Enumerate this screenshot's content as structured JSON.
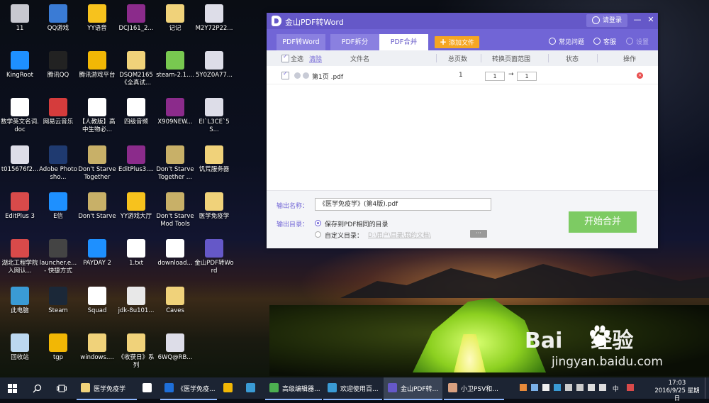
{
  "desktop": {
    "icons": [
      {
        "label": "11",
        "color": "#c8c8d0"
      },
      {
        "label": "QQ游戏",
        "color": "#3a7bd5"
      },
      {
        "label": "YY语音",
        "color": "#f7c21d"
      },
      {
        "label": "DCJ161_2...",
        "color": "#8b2b8b"
      },
      {
        "label": "记记",
        "color": "#f0d27a"
      },
      {
        "label": "M2Y72P22...",
        "color": "#dddde8"
      },
      {
        "label": "KingRoot",
        "color": "#1e90ff"
      },
      {
        "label": "腾讯QQ",
        "color": "#222222"
      },
      {
        "label": "腾讯游戏平台",
        "color": "#f2b705"
      },
      {
        "label": "DSQM2165《全真试...",
        "color": "#f0d27a"
      },
      {
        "label": "steam-2.1....",
        "color": "#78c850"
      },
      {
        "label": "5Y0Z0A77...",
        "color": "#dddde8"
      },
      {
        "label": "数学英文名词.doc",
        "color": "#ffffff"
      },
      {
        "label": "网易云音乐",
        "color": "#d53c3c"
      },
      {
        "label": "【人教版】高中生物必...",
        "color": "#ffffff"
      },
      {
        "label": "四级音频",
        "color": "#ffffff"
      },
      {
        "label": "X909NEW...",
        "color": "#8b2b8b"
      },
      {
        "label": "EI`L3CE`5S...",
        "color": "#dddde8"
      },
      {
        "label": "t015676f2...",
        "color": "#dddde8"
      },
      {
        "label": "Adobe Photosho...",
        "color": "#1f3a70"
      },
      {
        "label": "Don't Starve Together",
        "color": "#c8b068"
      },
      {
        "label": "EditPlus3....",
        "color": "#8b2b8b"
      },
      {
        "label": "Don't Starve Together ...",
        "color": "#c8b068"
      },
      {
        "label": "饥荒服务器",
        "color": "#f0d27a"
      },
      {
        "label": "EditPlus 3",
        "color": "#d84a4a"
      },
      {
        "label": "E信",
        "color": "#1e90ff"
      },
      {
        "label": "Don't Starve",
        "color": "#c8b068"
      },
      {
        "label": "YY游戏大厅",
        "color": "#f7c21d"
      },
      {
        "label": "Don't Starve Mod Tools",
        "color": "#c8b068"
      },
      {
        "label": "医学免疫学",
        "color": "#f0d27a"
      },
      {
        "label": "湖北工程学院入网认...",
        "color": "#d84a4a"
      },
      {
        "label": "launcher.e... - 快捷方式",
        "color": "#444444"
      },
      {
        "label": "PAYDAY 2",
        "color": "#1e90ff"
      },
      {
        "label": "1.txt",
        "color": "#ffffff"
      },
      {
        "label": "download...",
        "color": "#ffffff"
      },
      {
        "label": "金山PDF转Word",
        "color": "#6558c8"
      },
      {
        "label": "此电脑",
        "color": "#3a9bd5"
      },
      {
        "label": "Steam",
        "color": "#1b2838"
      },
      {
        "label": "Squad",
        "color": "#ffffff"
      },
      {
        "label": "jdk-8u101...",
        "color": "#e8e8e8"
      },
      {
        "label": "Caves",
        "color": "#f0d27a"
      },
      {
        "label": "回收站",
        "color": "#bcd8f0"
      },
      {
        "label": "tgp",
        "color": "#f2b705"
      },
      {
        "label": "windows....",
        "color": "#f0d27a"
      },
      {
        "label": "《收获日》系列",
        "color": "#f0d27a"
      },
      {
        "label": "6WQ@RB...",
        "color": "#dddde8"
      }
    ]
  },
  "window": {
    "title": "金山PDF转Word",
    "login_label": "请登录",
    "minimize_icon": "—",
    "close_icon": "✕",
    "tabs": [
      {
        "label": "PDF转Word"
      },
      {
        "label": "PDF拆分"
      },
      {
        "label": "PDF合并"
      }
    ],
    "add_file_label": "添加文件",
    "add_file_icon": "+",
    "tools": {
      "faq": "常见问题",
      "service": "客服",
      "settings": "设置"
    },
    "table": {
      "headers": {
        "select_all": "全选",
        "clear": "清除",
        "filename": "文件名",
        "total_pages": "总页数",
        "page_range": "转换页面范围",
        "status": "状态",
        "action": "操作"
      },
      "rows": [
        {
          "filename": "第1页 .pdf",
          "total_pages": "1",
          "range_from": "1",
          "range_to": "1",
          "range_sep": "→",
          "delete_icon": "×"
        }
      ]
    },
    "output": {
      "name_label": "输出名称：",
      "name_value": "《医学免疫学》(第4版).pdf",
      "dir_label": "输出目录：",
      "option_same": "保存到PDF相同的目录",
      "option_custom": "自定义目录：",
      "custom_path": "D:\\用户\\目录\\我的文档\\",
      "more_label": "···",
      "start_label": "开始合并"
    }
  },
  "taskbar": {
    "apps": [
      {
        "label": "医学免疫学",
        "color": "#f0d27a"
      },
      {
        "label": "",
        "color": "#ffffff"
      },
      {
        "label": "《医学免疫...",
        "color": "#1e6fd9"
      },
      {
        "label": "",
        "color": "#f2b705"
      },
      {
        "label": "",
        "color": "#3a9bd5"
      },
      {
        "label": "高级编辑器...",
        "color": "#4caf50"
      },
      {
        "label": "欢迎使用百...",
        "color": "#3a9bd5"
      },
      {
        "label": "金山PDF转...",
        "color": "#6558c8"
      },
      {
        "label": "小卫PSV和...",
        "color": "#d8a080"
      }
    ],
    "tray_lang": "中",
    "time": "17:03",
    "date": "2016/9/25 星期日"
  },
  "watermark": {
    "brand": "Bai",
    "brand_cn": "经验",
    "url": "jingyan.baidu.com"
  }
}
